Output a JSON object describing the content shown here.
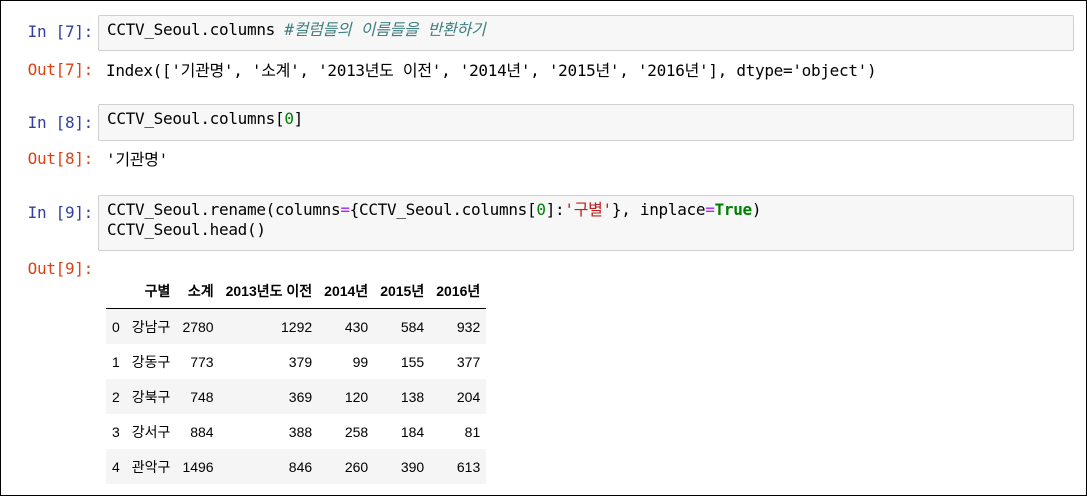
{
  "cells": [
    {
      "in_prompt": "In [7]:",
      "out_prompt": "Out[7]:",
      "code_a": "CCTV_Seoul.columns ",
      "comment": "#컬럼들의 이름들을 반환하기",
      "output": "Index(['기관명', '소계', '2013년도 이전', '2014년', '2015년', '2016년'], dtype='object')"
    },
    {
      "in_prompt": "In [8]:",
      "out_prompt": "Out[8]:",
      "code_a": "CCTV_Seoul.columns[",
      "code_num": "0",
      "code_b": "]",
      "output": "'기관명'"
    },
    {
      "in_prompt": "In [9]:",
      "out_prompt": "Out[9]:",
      "line1_a": "CCTV_Seoul.rename(columns",
      "line1_eq": "=",
      "line1_b": "{CCTV_Seoul.columns[",
      "line1_num": "0",
      "line1_c": "]:",
      "line1_str": "'구별'",
      "line1_d": "}, inplace",
      "line1_eq2": "=",
      "line1_true": "True",
      "line1_e": ")",
      "line2": "CCTV_Seoul.head()"
    }
  ],
  "dataframe": {
    "columns": [
      "",
      "구별",
      "소계",
      "2013년도 이전",
      "2014년",
      "2015년",
      "2016년"
    ],
    "rows": [
      [
        "0",
        "강남구",
        "2780",
        "1292",
        "430",
        "584",
        "932"
      ],
      [
        "1",
        "강동구",
        "773",
        "379",
        "99",
        "155",
        "377"
      ],
      [
        "2",
        "강북구",
        "748",
        "369",
        "120",
        "138",
        "204"
      ],
      [
        "3",
        "강서구",
        "884",
        "388",
        "258",
        "184",
        "81"
      ],
      [
        "4",
        "관악구",
        "1496",
        "846",
        "260",
        "390",
        "613"
      ]
    ]
  }
}
